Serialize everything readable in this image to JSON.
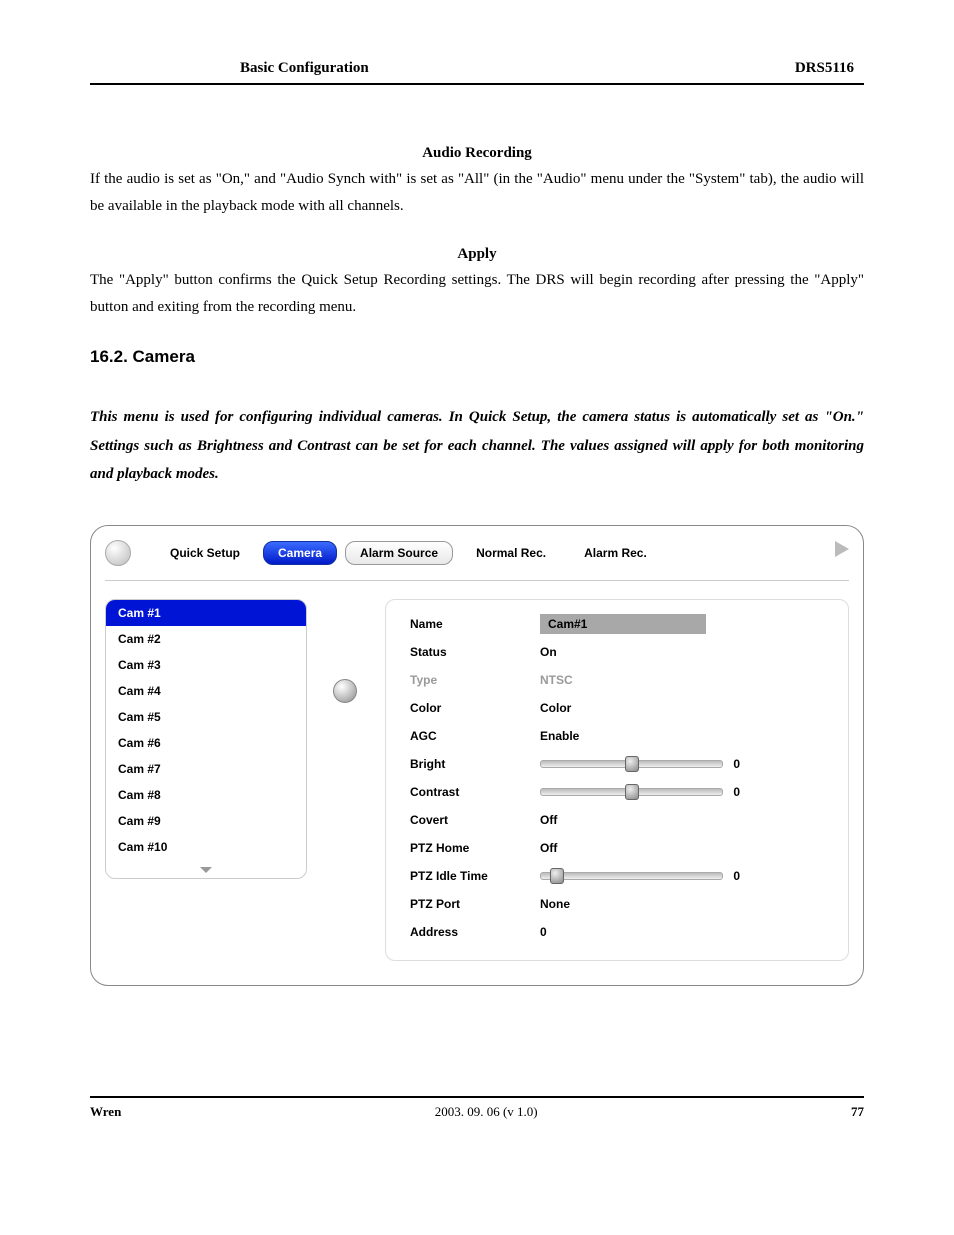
{
  "header": {
    "left": "Basic Configuration",
    "right": "DRS5116"
  },
  "section1": {
    "heading": "Audio Recording",
    "body": "If the audio is set as \"On,\" and \"Audio Synch with\" is set as \"All\" (in the \"Audio\" menu under the \"System\" tab), the audio will be available in the playback mode with all channels."
  },
  "section2": {
    "heading": "Apply",
    "body": "The \"Apply\" button confirms the Quick Setup Recording settings.   The DRS will begin recording after pressing the \"Apply\" button and exiting from the recording menu."
  },
  "h2": "16.2. Camera",
  "intro": "This menu is used for configuring individual cameras.  In Quick Setup, the camera status is automatically set as \"On.\"  Settings such as Brightness and Contrast can be set for each channel.  The values assigned will apply for both monitoring and playback modes.",
  "ui": {
    "tabs": [
      "Quick Setup",
      "Camera",
      "Alarm Source",
      "Normal Rec.",
      "Alarm Rec."
    ],
    "active_tab_index": 1,
    "cams": [
      "Cam #1",
      "Cam #2",
      "Cam #3",
      "Cam #4",
      "Cam #5",
      "Cam #6",
      "Cam #7",
      "Cam #8",
      "Cam #9",
      "Cam #10"
    ],
    "selected_cam_index": 0,
    "props": {
      "name_label": "Name",
      "name_value": "Cam#1",
      "status_label": "Status",
      "status_value": "On",
      "type_label": "Type",
      "type_value": "NTSC",
      "color_label": "Color",
      "color_value": "Color",
      "agc_label": "AGC",
      "agc_value": "Enable",
      "bright_label": "Bright",
      "bright_value": "0",
      "contrast_label": "Contrast",
      "contrast_value": "0",
      "covert_label": "Covert",
      "covert_value": "Off",
      "ptzhome_label": "PTZ Home",
      "ptzhome_value": "Off",
      "ptzidle_label": "PTZ Idle Time",
      "ptzidle_value": "0",
      "ptzport_label": "PTZ Port",
      "ptzport_value": "None",
      "address_label": "Address",
      "address_value": "0"
    }
  },
  "footer": {
    "brand": "Wren",
    "center": "2003. 09. 06 (v 1.0)",
    "page": "77"
  },
  "chart_data": {
    "type": "table",
    "title": "Camera settings — Cam #1",
    "columns": [
      "Property",
      "Value"
    ],
    "rows": [
      [
        "Name",
        "Cam#1"
      ],
      [
        "Status",
        "On"
      ],
      [
        "Type",
        "NTSC"
      ],
      [
        "Color",
        "Color"
      ],
      [
        "AGC",
        "Enable"
      ],
      [
        "Bright",
        0
      ],
      [
        "Contrast",
        0
      ],
      [
        "Covert",
        "Off"
      ],
      [
        "PTZ Home",
        "Off"
      ],
      [
        "PTZ Idle Time",
        0
      ],
      [
        "PTZ Port",
        "None"
      ],
      [
        "Address",
        0
      ]
    ],
    "slider_ranges": {
      "Bright": null,
      "Contrast": null,
      "PTZ Idle Time": null
    }
  }
}
